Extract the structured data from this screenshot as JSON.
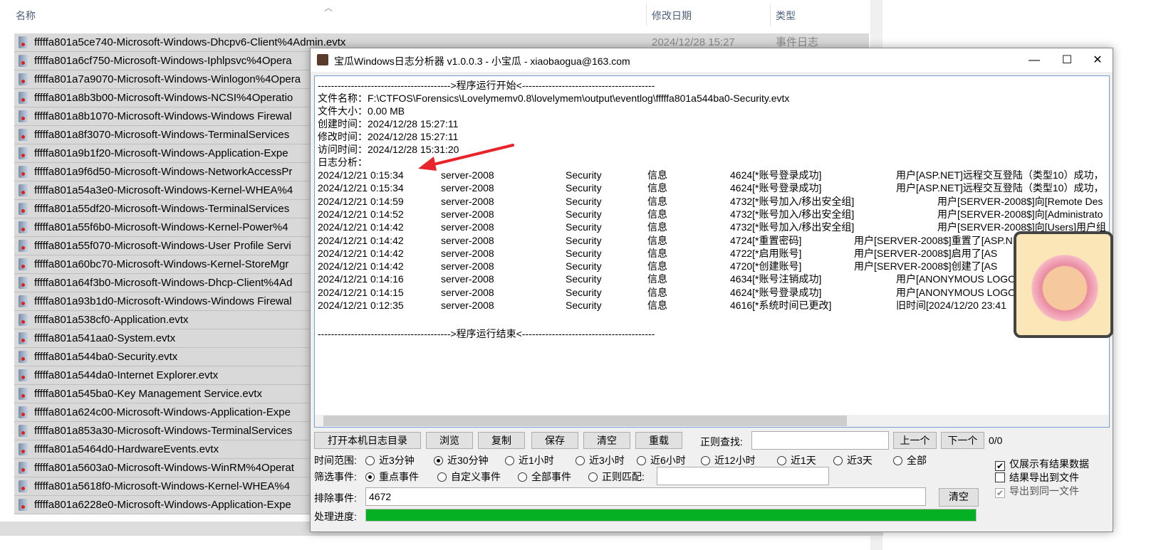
{
  "explorer": {
    "columns": {
      "name": "名称",
      "modified": "修改日期",
      "type": "类型"
    },
    "first_row_date": "2024/12/28 15:27",
    "first_row_type": "事件日志",
    "files": [
      "fffffa801a5ce740-Microsoft-Windows-Dhcpv6-Client%4Admin.evtx",
      "fffffa801a6cf750-Microsoft-Windows-Iphlpsvc%4Opera",
      "fffffa801a7a9070-Microsoft-Windows-Winlogon%4Opera",
      "fffffa801a8b3b00-Microsoft-Windows-NCSI%4Operatio",
      "fffffa801a8b1070-Microsoft-Windows-Windows Firewal",
      "fffffa801a8f3070-Microsoft-Windows-TerminalServices",
      "fffffa801a9b1f20-Microsoft-Windows-Application-Expe",
      "fffffa801a9f6d50-Microsoft-Windows-NetworkAccessPr",
      "fffffa801a54a3e0-Microsoft-Windows-Kernel-WHEA%4",
      "fffffa801a55df20-Microsoft-Windows-TerminalServices",
      "fffffa801a55f6b0-Microsoft-Windows-Kernel-Power%4",
      "fffffa801a55f070-Microsoft-Windows-User Profile Servi",
      "fffffa801a60bc70-Microsoft-Windows-Kernel-StoreMgr",
      "fffffa801a64f3b0-Microsoft-Windows-Dhcp-Client%4Ad",
      "fffffa801a93b1d0-Microsoft-Windows-Windows Firewal",
      "fffffa801a538cf0-Application.evtx",
      "fffffa801a541aa0-System.evtx",
      "fffffa801a544ba0-Security.evtx",
      "fffffa801a544da0-Internet Explorer.evtx",
      "fffffa801a545ba0-Key Management Service.evtx",
      "fffffa801a624c00-Microsoft-Windows-Application-Expe",
      "fffffa801a853a30-Microsoft-Windows-TerminalServices",
      "fffffa801a5464d0-HardwareEvents.evtx",
      "fffffa801a5603a0-Microsoft-Windows-WinRM%4Operat",
      "fffffa801a5618f0-Microsoft-Windows-Kernel-WHEA%4",
      "fffffa801a6228e0-Microsoft-Windows-Application-Expe"
    ]
  },
  "window": {
    "title": "宝瓜Windows日志分析器 v1.0.0.3 - 小宝瓜 - xiaobaogua@163.com",
    "minimize": "—",
    "maximize": "☐",
    "close": "✕"
  },
  "log": {
    "start_line": "---------------------------------------->程序运行开始<----------------------------------------",
    "end_line": "---------------------------------------->程序运行结束<----------------------------------------",
    "info": [
      "文件名称：F:\\CTFOS\\Forensics\\Lovelymemv0.8\\lovelymem\\output\\eventlog\\fffffa801a544ba0-Security.evtx",
      "文件大小：0.00 MB",
      "创建时间：2024/12/28 15:27:11",
      "修改时间：2024/12/28 15:27:11",
      "访问时间：2024/12/28 15:31:20",
      "日志分析："
    ],
    "entries": [
      {
        "time": "2024/12/21 0:15:34",
        "host": "server-2008",
        "source": "Security",
        "level": "信息",
        "event": "4624[*账号登录成功]",
        "desc": "用户[ASP.NET]远程交互登陆（类型10）成功，"
      },
      {
        "time": "2024/12/21 0:15:34",
        "host": "server-2008",
        "source": "Security",
        "level": "信息",
        "event": "4624[*账号登录成功]",
        "desc": "用户[ASP.NET]远程交互登陆（类型10）成功，"
      },
      {
        "time": "2024/12/21 0:14:59",
        "host": "server-2008",
        "source": "Security",
        "level": "信息",
        "event": "4732[*账号加入/移出安全组]",
        "desc": "用户[SERVER-2008$]向[Remote Des"
      },
      {
        "time": "2024/12/21 0:14:52",
        "host": "server-2008",
        "source": "Security",
        "level": "信息",
        "event": "4732[*账号加入/移出安全组]",
        "desc": "用户[SERVER-2008$]向[Administrato"
      },
      {
        "time": "2024/12/21 0:14:42",
        "host": "server-2008",
        "source": "Security",
        "level": "信息",
        "event": "4732[*账号加入/移出安全组]",
        "desc": "用户[SERVER-2008$]向[Users]用户组"
      },
      {
        "time": "2024/12/21 0:14:42",
        "host": "server-2008",
        "source": "Security",
        "level": "信息",
        "event": "4724[*重置密码]",
        "desc": "用户[SERVER-2008$]重置了[ASP.N"
      },
      {
        "time": "2024/12/21 0:14:42",
        "host": "server-2008",
        "source": "Security",
        "level": "信息",
        "event": "4722[*启用账号]",
        "desc": "用户[SERVER-2008$]启用了[AS"
      },
      {
        "time": "2024/12/21 0:14:42",
        "host": "server-2008",
        "source": "Security",
        "level": "信息",
        "event": "4720[*创建账号]",
        "desc": "用户[SERVER-2008$]创建了[AS"
      },
      {
        "time": "2024/12/21 0:14:16",
        "host": "server-2008",
        "source": "Security",
        "level": "信息",
        "event": "4634[*账号注销成功]",
        "desc": "用户[ANONYMOUS LOGO"
      },
      {
        "time": "2024/12/21 0:14:15",
        "host": "server-2008",
        "source": "Security",
        "level": "信息",
        "event": "4624[*账号登录成功]",
        "desc": "用户[ANONYMOUS LOGO"
      },
      {
        "time": "2024/12/21 0:12:35",
        "host": "server-2008",
        "source": "Security",
        "level": "信息",
        "event": "4616[*系统时间已更改]",
        "desc": "旧时间[2024/12/20 23:41"
      }
    ]
  },
  "toolbar": {
    "open_local": "打开本机日志目录",
    "browse": "浏览",
    "copy": "复制",
    "save": "保存",
    "clear": "清空",
    "reload": "重载",
    "regex_label": "正则查找:",
    "regex_value": "",
    "prev": "上一个",
    "next": "下一个",
    "count": "0/0"
  },
  "time_range": {
    "label": "时间范围:",
    "options": [
      "近3分钟",
      "近30分钟",
      "近1小时",
      "近3小时",
      "近6小时",
      "近12小时",
      "近1天",
      "近3天",
      "全部"
    ],
    "selected": 1
  },
  "filter": {
    "label": "筛选事件:",
    "options": [
      "重点事件",
      "自定义事件",
      "全部事件",
      "正则匹配:"
    ],
    "selected": 0,
    "regex_value": ""
  },
  "exclude": {
    "label": "排除事件:",
    "value": "4672",
    "clear": "清空"
  },
  "options": [
    {
      "label": "仅展示有结果数据",
      "checked": true,
      "disabled": false
    },
    {
      "label": "结果导出到文件",
      "checked": false,
      "disabled": false
    },
    {
      "label": "导出到同一文件",
      "checked": true,
      "disabled": true
    }
  ],
  "progress": {
    "label": "处理进度:",
    "value": 100,
    "color": "#06b025"
  }
}
